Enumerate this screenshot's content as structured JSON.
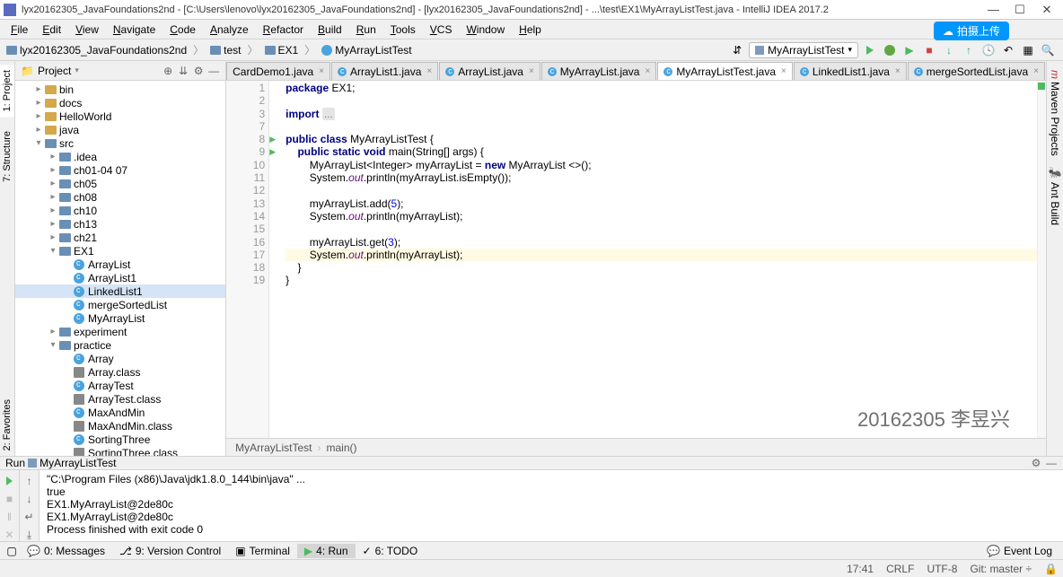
{
  "window": {
    "title": "lyx20162305_JavaFoundations2nd - [C:\\Users\\lenovo\\lyx20162305_JavaFoundations2nd] - [lyx20162305_JavaFoundations2nd] - ...\\test\\EX1\\MyArrayListTest.java - IntelliJ IDEA 2017.2"
  },
  "upload_btn": "拍摄上传",
  "menu": [
    "File",
    "Edit",
    "View",
    "Navigate",
    "Code",
    "Analyze",
    "Refactor",
    "Build",
    "Run",
    "Tools",
    "VCS",
    "Window",
    "Help"
  ],
  "breadcrumb": [
    {
      "icon": "folder",
      "label": "lyx20162305_JavaFoundations2nd"
    },
    {
      "icon": "folder",
      "label": "test"
    },
    {
      "icon": "folder",
      "label": "EX1"
    },
    {
      "icon": "class",
      "label": "MyArrayListTest"
    }
  ],
  "run_config": "MyArrayListTest",
  "left_sidebar": [
    {
      "label": "1: Project",
      "active": true
    },
    {
      "label": "7: Structure",
      "active": false
    }
  ],
  "right_sidebar": [
    "Maven Projects",
    "Ant Build"
  ],
  "project_panel": {
    "title": "Project"
  },
  "tree": [
    {
      "indent": 1,
      "arrow": ">",
      "icon": "dir",
      "label": "bin"
    },
    {
      "indent": 1,
      "arrow": ">",
      "icon": "dir",
      "label": "docs"
    },
    {
      "indent": 1,
      "arrow": ">",
      "icon": "dir",
      "label": "HelloWorld"
    },
    {
      "indent": 1,
      "arrow": ">",
      "icon": "dir",
      "label": "java"
    },
    {
      "indent": 1,
      "arrow": "v",
      "icon": "dirb",
      "label": "src"
    },
    {
      "indent": 2,
      "arrow": ">",
      "icon": "dirb",
      "label": ".idea"
    },
    {
      "indent": 2,
      "arrow": ">",
      "icon": "dirb",
      "label": "ch01-04 07"
    },
    {
      "indent": 2,
      "arrow": ">",
      "icon": "dirb",
      "label": "ch05"
    },
    {
      "indent": 2,
      "arrow": ">",
      "icon": "dirb",
      "label": "ch08"
    },
    {
      "indent": 2,
      "arrow": ">",
      "icon": "dirb",
      "label": "ch10"
    },
    {
      "indent": 2,
      "arrow": ">",
      "icon": "dirb",
      "label": "ch13"
    },
    {
      "indent": 2,
      "arrow": ">",
      "icon": "dirb",
      "label": "ch21"
    },
    {
      "indent": 2,
      "arrow": "v",
      "icon": "dirb",
      "label": "EX1"
    },
    {
      "indent": 3,
      "arrow": "",
      "icon": "c",
      "label": "ArrayList"
    },
    {
      "indent": 3,
      "arrow": "",
      "icon": "c",
      "label": "ArrayList1"
    },
    {
      "indent": 3,
      "arrow": "",
      "icon": "c",
      "label": "LinkedList1",
      "sel": true
    },
    {
      "indent": 3,
      "arrow": "",
      "icon": "c",
      "label": "mergeSortedList"
    },
    {
      "indent": 3,
      "arrow": "",
      "icon": "c",
      "label": "MyArrayList"
    },
    {
      "indent": 2,
      "arrow": ">",
      "icon": "dirb",
      "label": "experiment"
    },
    {
      "indent": 2,
      "arrow": "v",
      "icon": "dirb",
      "label": "practice"
    },
    {
      "indent": 3,
      "arrow": "",
      "icon": "c",
      "label": "Array"
    },
    {
      "indent": 3,
      "arrow": "",
      "icon": "f",
      "label": "Array.class"
    },
    {
      "indent": 3,
      "arrow": "",
      "icon": "c",
      "label": "ArrayTest"
    },
    {
      "indent": 3,
      "arrow": "",
      "icon": "f",
      "label": "ArrayTest.class"
    },
    {
      "indent": 3,
      "arrow": "",
      "icon": "c",
      "label": "MaxAndMin"
    },
    {
      "indent": 3,
      "arrow": "",
      "icon": "f",
      "label": "MaxAndMin.class"
    },
    {
      "indent": 3,
      "arrow": "",
      "icon": "c",
      "label": "SortingThree"
    },
    {
      "indent": 3,
      "arrow": "",
      "icon": "f",
      "label": "SortingThree.class"
    }
  ],
  "tabs": [
    {
      "label": "CardDemo1.java",
      "active": false,
      "partial": true
    },
    {
      "label": "ArrayList1.java",
      "active": false
    },
    {
      "label": "ArrayList.java",
      "active": false
    },
    {
      "label": "MyArrayList.java",
      "active": false
    },
    {
      "label": "MyArrayListTest.java",
      "active": true
    },
    {
      "label": "LinkedList1.java",
      "active": false
    },
    {
      "label": "mergeSortedList.java",
      "active": false
    }
  ],
  "code_lines": [
    {
      "n": 1,
      "html": "<span class='kw'>package</span> EX1;"
    },
    {
      "n": 2,
      "html": ""
    },
    {
      "n": 3,
      "html": "<span class='kw'>import</span> <span class='folded'>...</span>"
    },
    {
      "n": 7,
      "html": ""
    },
    {
      "n": 8,
      "run": true,
      "html": "<span class='kw'>public class</span> MyArrayListTest {"
    },
    {
      "n": 9,
      "run": true,
      "html": "    <span class='kw'>public static void</span> main(String[] args) {"
    },
    {
      "n": 10,
      "html": "        MyArrayList&lt;Integer&gt; myArrayList = <span class='kw'>new</span> MyArrayList &lt;&gt;();"
    },
    {
      "n": 11,
      "html": "        System.<span class='field'>out</span>.println(myArrayList.isEmpty());"
    },
    {
      "n": 12,
      "html": ""
    },
    {
      "n": 13,
      "html": "        myArrayList.add(<span class='num'>5</span>);"
    },
    {
      "n": 14,
      "html": "        System.<span class='field'>out</span>.println(myArrayList);"
    },
    {
      "n": 15,
      "html": ""
    },
    {
      "n": 16,
      "html": "        myArrayList.get(<span class='num'>3</span>);"
    },
    {
      "n": 17,
      "hl": true,
      "html": "        System.<span class='field'>out</span>.println(myArrayList);"
    },
    {
      "n": 18,
      "html": "    }"
    },
    {
      "n": 19,
      "html": "}"
    }
  ],
  "watermark": "20162305 李昱兴",
  "editor_breadcrumb": [
    "MyArrayListTest",
    "main()"
  ],
  "run_panel": {
    "title": "Run",
    "config": "MyArrayListTest",
    "output": [
      "\"C:\\Program Files (x86)\\Java\\jdk1.8.0_144\\bin\\java\" ...",
      "true",
      "EX1.MyArrayList@2de80c",
      "EX1.MyArrayList@2de80c",
      "",
      "Process finished with exit code 0"
    ]
  },
  "bottom_bar": [
    {
      "label": "0: Messages"
    },
    {
      "label": "9: Version Control"
    },
    {
      "label": "Terminal"
    },
    {
      "label": "4: Run",
      "active": true
    },
    {
      "label": "6: TODO"
    }
  ],
  "event_log": "Event Log",
  "statusbar": {
    "time": "17:41",
    "line_end": "CRLF",
    "sep": "÷",
    "enc": "UTF-8",
    "sep2": "÷",
    "git": "Git: master ÷"
  },
  "left_sidebar_bottom": "2: Favorites"
}
